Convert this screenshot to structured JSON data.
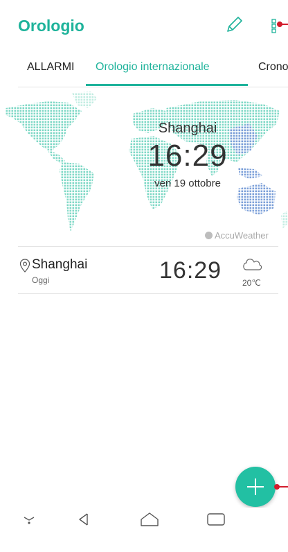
{
  "app": {
    "title": "Orologio"
  },
  "tabs": [
    {
      "label": "ALLARMI",
      "active": false
    },
    {
      "label": "Orologio internazionale",
      "active": true
    },
    {
      "label": "Cronog",
      "active": false
    }
  ],
  "map": {
    "city": "Shanghai",
    "time": "16:29",
    "date": "ven 19 ottobre",
    "provider": "AccuWeather"
  },
  "cities": [
    {
      "name": "Shanghai",
      "day": "Oggi",
      "time": "16:29",
      "temperature": "20℃",
      "weather_icon": "cloud-icon"
    }
  ],
  "icons": {
    "edit": "pencil-icon",
    "menu": "more-vertical-icon",
    "fab": "plus-icon",
    "nav": [
      "nav-down-icon",
      "back-icon",
      "home-icon",
      "recents-icon"
    ]
  },
  "colors": {
    "accent": "#1fb39b",
    "fab": "#22c0a3",
    "map_dots": "#7fd8c6",
    "map_dots_highlight": "#7b9fd8",
    "marker": "#d21c2c"
  }
}
